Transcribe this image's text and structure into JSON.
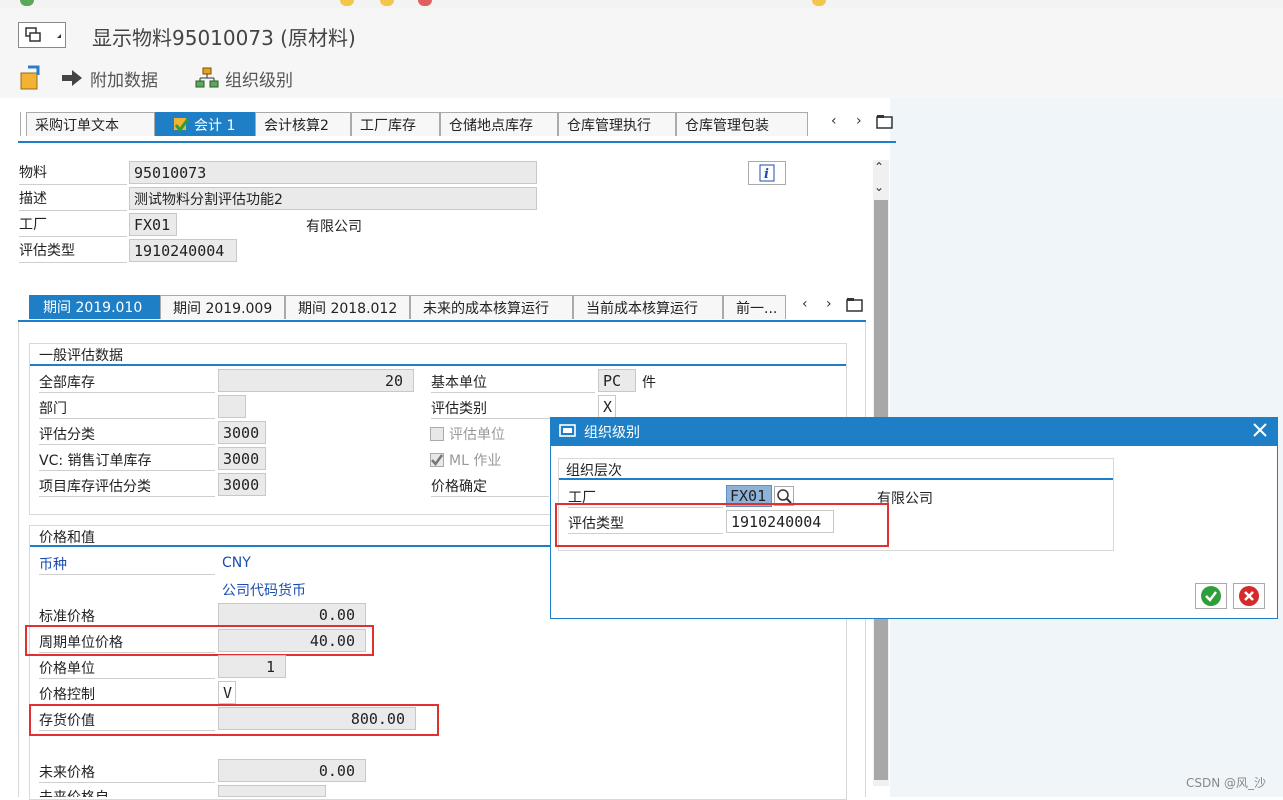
{
  "window": {
    "title": "显示物料95010073 (原材料)"
  },
  "toolbar": {
    "additional_data": "附加数据",
    "org_levels": "组织级别"
  },
  "tabs": [
    {
      "label": "采购订单文本"
    },
    {
      "label": "会计 1"
    },
    {
      "label": "会计核算2"
    },
    {
      "label": "工厂库存"
    },
    {
      "label": "仓储地点库存"
    },
    {
      "label": "仓库管理执行"
    },
    {
      "label": "仓库管理包装"
    }
  ],
  "header": {
    "material_label": "物料",
    "material_value": "95010073",
    "desc_label": "描述",
    "desc_value": "测试物料分割评估功能2",
    "plant_label": "工厂",
    "plant_value": "FX01",
    "plant_name": "有限公司",
    "valtype_label": "评估类型",
    "valtype_value": "1910240004"
  },
  "period_tabs": [
    {
      "label": "期间 2019.010"
    },
    {
      "label": "期间 2019.009"
    },
    {
      "label": "期间 2018.012"
    },
    {
      "label": "未来的成本核算运行"
    },
    {
      "label": "当前成本核算运行"
    },
    {
      "label": "前一..."
    }
  ],
  "general": {
    "title": "一般评估数据",
    "total_stock_label": "全部库存",
    "total_stock": "20",
    "base_unit_label": "基本单位",
    "base_unit": "PC",
    "base_unit_text": "件",
    "division_label": "部门",
    "division": "",
    "val_cat_label": "评估类别",
    "val_cat": "X",
    "val_class_label": "评估分类",
    "val_class": "3000",
    "val_unit_label": "评估单位",
    "vc_label": "VC: 销售订单库存",
    "vc_value": "3000",
    "ml_label": "ML 作业",
    "project_label": "项目库存评估分类",
    "project_value": "3000",
    "price_det_label": "价格确定"
  },
  "prices": {
    "title": "价格和值",
    "currency_label": "币种",
    "currency_value": "CNY",
    "company_currency": "公司代码货币",
    "std_price_label": "标准价格",
    "std_price": "0.00",
    "periodic_price_label": "周期单位价格",
    "periodic_price": "40.00",
    "price_unit_label": "价格单位",
    "price_unit": "1",
    "price_control_label": "价格控制",
    "price_control": "V",
    "stock_value_label": "存货价值",
    "stock_value": "800.00",
    "future_price_label": "未来价格",
    "future_price": "0.00",
    "future_price_from_label": "未来价格自"
  },
  "dialog": {
    "title": "组织级别",
    "group_title": "组织层次",
    "plant_label": "工厂",
    "plant_value": "FX01",
    "plant_name": "有限公司",
    "valtype_label": "评估类型",
    "valtype_value": "1910240004"
  },
  "watermark": "CSDN @风_沙",
  "colors": {
    "accent": "#1f7fc6",
    "highlight_red": "#e03030",
    "confirm_green": "#2e9e3a",
    "cancel_red": "#d42a2a"
  }
}
